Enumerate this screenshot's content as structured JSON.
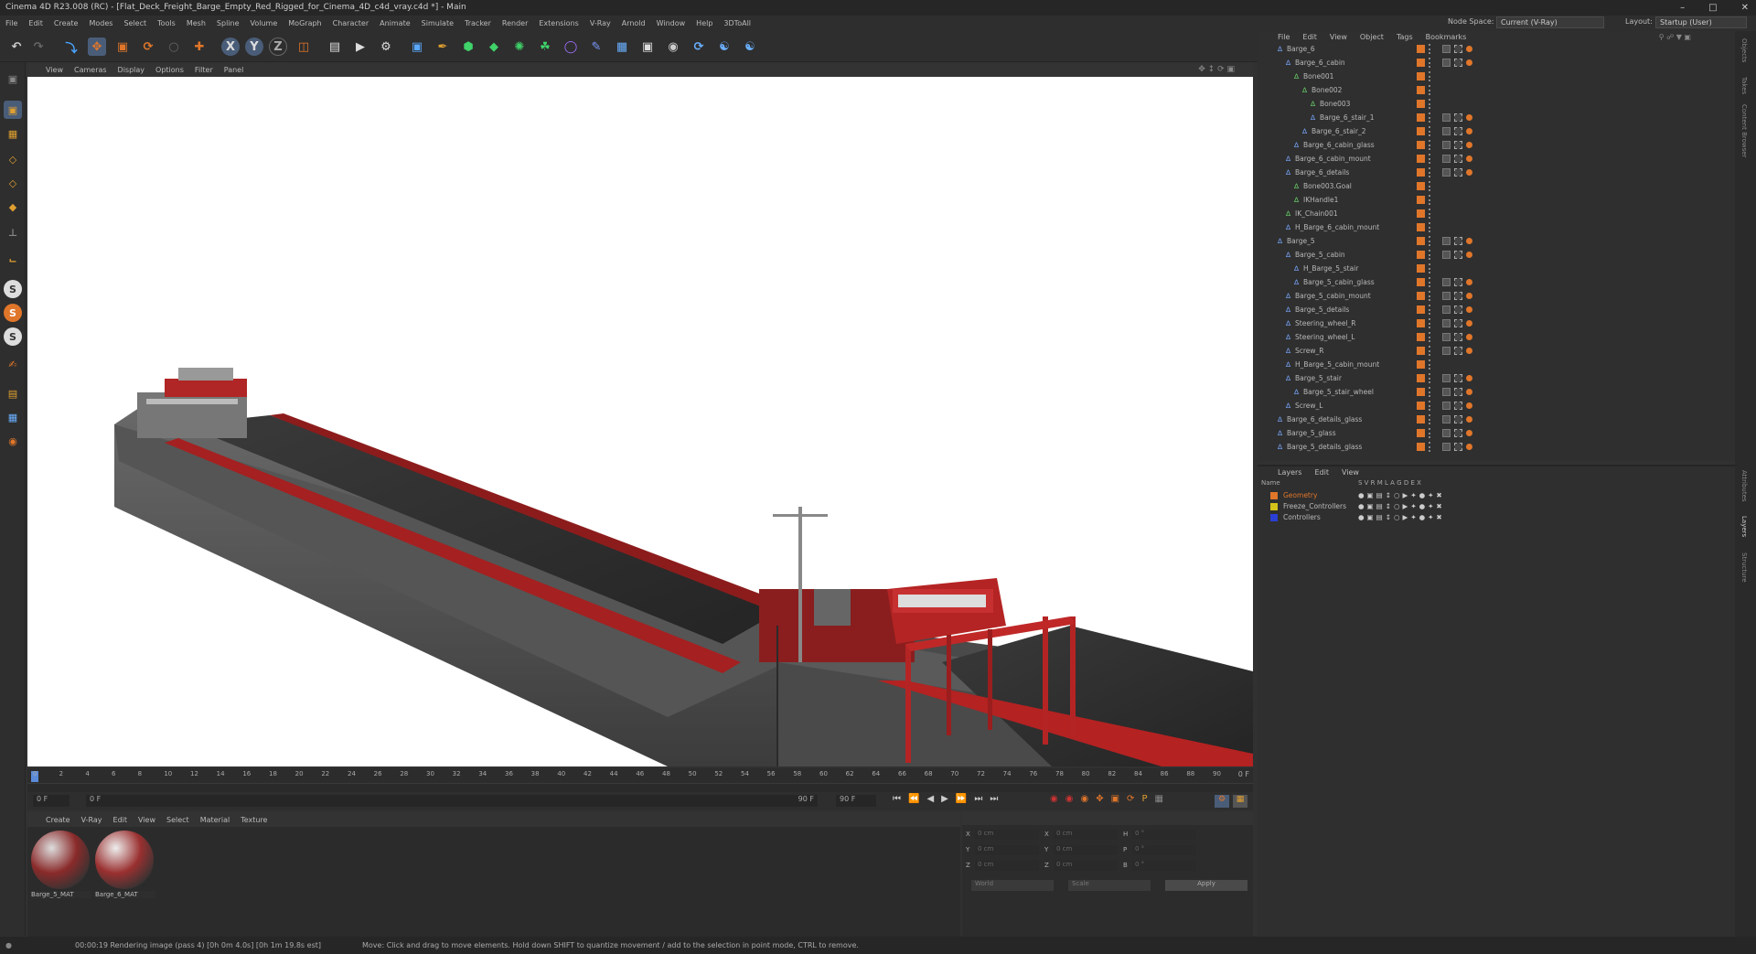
{
  "window": {
    "title": "Cinema 4D R23.008 (RC) - [Flat_Deck_Freight_Barge_Empty_Red_Rigged_for_Cinema_4D_c4d_vray.c4d *] - Main"
  },
  "menubar": {
    "items": [
      "File",
      "Edit",
      "Create",
      "Modes",
      "Select",
      "Tools",
      "Mesh",
      "Spline",
      "Volume",
      "MoGraph",
      "Character",
      "Animate",
      "Simulate",
      "Tracker",
      "Render",
      "Extensions",
      "V-Ray",
      "Arnold",
      "Window",
      "Help",
      "3DToAll"
    ],
    "node_space_label": "Node Space:",
    "node_space_value": "Current (V-Ray)",
    "layout_label": "Layout:",
    "layout_value": "Startup (User)"
  },
  "toolbar": {
    "axis_x": "X",
    "axis_y": "Y",
    "axis_z": "Z"
  },
  "viewport_menu": [
    "View",
    "Cameras",
    "Display",
    "Options",
    "Filter",
    "Panel"
  ],
  "object_manager": {
    "menu": [
      "File",
      "Edit",
      "View",
      "Object",
      "Tags",
      "Bookmarks"
    ],
    "rows": [
      {
        "name": "Barge_6",
        "indent": 0
      },
      {
        "name": "Barge_6_cabin",
        "indent": 1
      },
      {
        "name": "Bone001",
        "indent": 2
      },
      {
        "name": "Bone002",
        "indent": 3
      },
      {
        "name": "Bone003",
        "indent": 4
      },
      {
        "name": "Barge_6_stair_1",
        "indent": 4
      },
      {
        "name": "Barge_6_stair_2",
        "indent": 3
      },
      {
        "name": "Barge_6_cabin_glass",
        "indent": 2
      },
      {
        "name": "Barge_6_cabin_mount",
        "indent": 1
      },
      {
        "name": "Barge_6_details",
        "indent": 1
      },
      {
        "name": "Bone003.Goal",
        "indent": 2
      },
      {
        "name": "IKHandle1",
        "indent": 2
      },
      {
        "name": "IK_Chain001",
        "indent": 1
      },
      {
        "name": "H_Barge_6_cabin_mount",
        "indent": 1
      },
      {
        "name": "Barge_5",
        "indent": 0
      },
      {
        "name": "Barge_5_cabin",
        "indent": 1
      },
      {
        "name": "H_Barge_5_stair",
        "indent": 2
      },
      {
        "name": "Barge_5_cabin_glass",
        "indent": 2
      },
      {
        "name": "Barge_5_cabin_mount",
        "indent": 1
      },
      {
        "name": "Barge_5_details",
        "indent": 1
      },
      {
        "name": "Steering_wheel_R",
        "indent": 1
      },
      {
        "name": "Steering_wheel_L",
        "indent": 1
      },
      {
        "name": "Screw_R",
        "indent": 1
      },
      {
        "name": "H_Barge_5_cabin_mount",
        "indent": 1
      },
      {
        "name": "Barge_5_stair",
        "indent": 1
      },
      {
        "name": "Barge_5_stair_wheel",
        "indent": 2
      },
      {
        "name": "Screw_L",
        "indent": 1
      },
      {
        "name": "Barge_6_details_glass",
        "indent": 0
      },
      {
        "name": "Barge_5_glass",
        "indent": 0
      },
      {
        "name": "Barge_5_details_glass",
        "indent": 0
      }
    ]
  },
  "layers": {
    "menu": [
      "Layers",
      "Edit",
      "View"
    ],
    "header_name": "Name",
    "header_cols": "S  V  R  M  L  A  G  D  E  X",
    "items": [
      {
        "name": "Geometry",
        "color": "#e0762a"
      },
      {
        "name": "Freeze_Controllers",
        "color": "#d4c21a"
      },
      {
        "name": "Controllers",
        "color": "#2a3fd4"
      }
    ]
  },
  "timeline": {
    "ticks": [
      "0",
      "2",
      "4",
      "6",
      "8",
      "10",
      "12",
      "14",
      "16",
      "18",
      "20",
      "22",
      "24",
      "26",
      "28",
      "30",
      "32",
      "34",
      "36",
      "38",
      "40",
      "42",
      "44",
      "46",
      "48",
      "50",
      "52",
      "54",
      "56",
      "58",
      "60",
      "62",
      "64",
      "66",
      "68",
      "70",
      "72",
      "74",
      "76",
      "78",
      "80",
      "82",
      "84",
      "86",
      "88",
      "90"
    ],
    "current_frame": "0 F"
  },
  "transport": {
    "start": "0 F",
    "min": "0 F",
    "max": "90 F",
    "end": "90 F"
  },
  "material_manager": {
    "menu": [
      "Create",
      "V-Ray",
      "Edit",
      "View",
      "Select",
      "Material",
      "Texture"
    ],
    "materials": [
      {
        "name": "Barge_5_MAT"
      },
      {
        "name": "Barge_6_MAT"
      }
    ]
  },
  "coordinates": {
    "rows": [
      {
        "a": "X",
        "av": "0 cm",
        "b": "X",
        "bv": "0 cm",
        "c": "H",
        "cv": "0 °"
      },
      {
        "a": "Y",
        "av": "0 cm",
        "b": "Y",
        "bv": "0 cm",
        "c": "P",
        "cv": "0 °"
      },
      {
        "a": "Z",
        "av": "0 cm",
        "b": "Z",
        "bv": "0 cm",
        "c": "B",
        "cv": "0 °"
      }
    ],
    "mode1": "World",
    "mode2": "Scale",
    "apply": "Apply"
  },
  "statusbar": {
    "render": "00:00:19 Rendering image (pass 4) [0h 0m 4.0s] [0h 1m 19.8s est]",
    "hint": "Move: Click and drag to move elements. Hold down SHIFT to quantize movement / add to the selection in point mode, CTRL to remove."
  },
  "side_tabs": [
    "Objects",
    "Takes",
    "Content Browser",
    "Attributes",
    "Layers",
    "Structure"
  ]
}
